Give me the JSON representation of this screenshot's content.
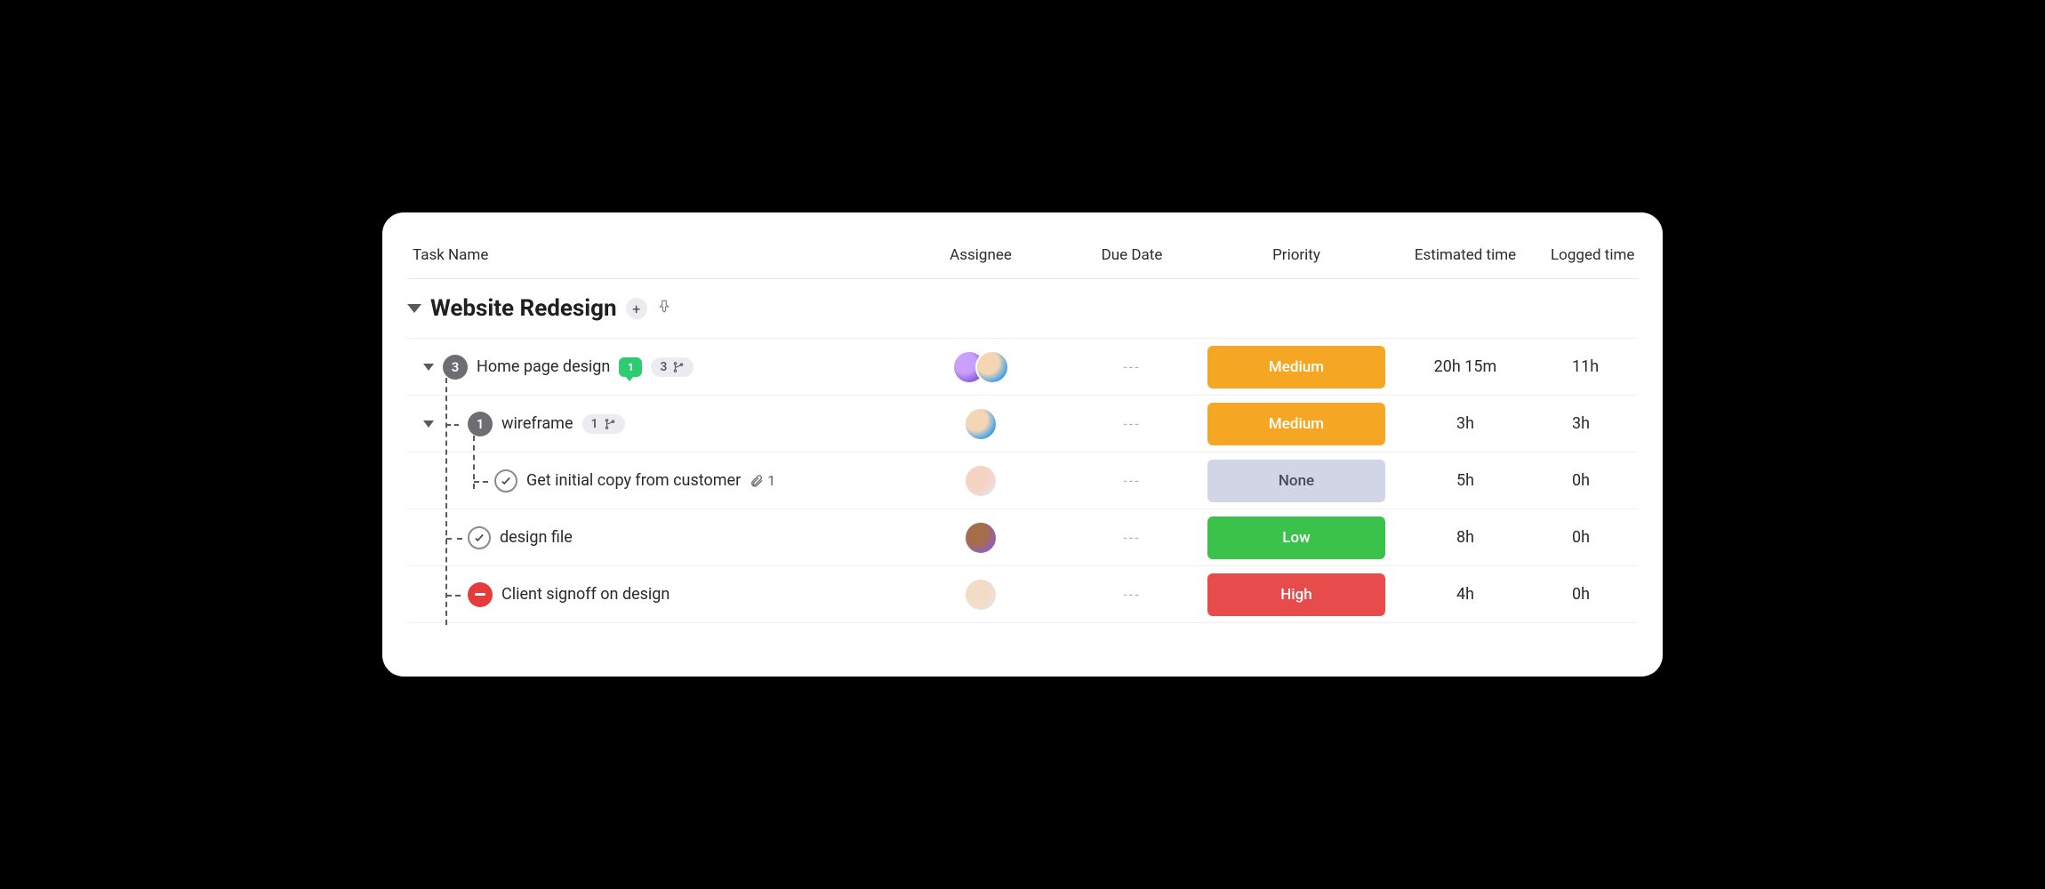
{
  "columns": {
    "task_name": "Task Name",
    "assignee": "Assignee",
    "due_date": "Due Date",
    "priority": "Priority",
    "estimated": "Estimated time",
    "logged": "Logged time"
  },
  "section": {
    "title": "Website Redesign",
    "add_label": "+"
  },
  "priority_labels": {
    "medium": "Medium",
    "none": "None",
    "low": "Low",
    "high": "High"
  },
  "tasks": [
    {
      "id": "home",
      "title": "Home page design",
      "subtask_count": "3",
      "comment_count": "1",
      "subtask_badge": "3",
      "due_date": "---",
      "priority": "medium",
      "estimated": "20h 15m",
      "logged": "11h"
    },
    {
      "id": "wireframe",
      "title": "wireframe",
      "subtask_count": "1",
      "subtask_badge": "1",
      "due_date": "---",
      "priority": "medium",
      "estimated": "3h",
      "logged": "3h"
    },
    {
      "id": "copy",
      "title": "Get initial copy from customer",
      "attachment_count": "1",
      "due_date": "---",
      "priority": "none",
      "estimated": "5h",
      "logged": "0h"
    },
    {
      "id": "designfile",
      "title": "design file",
      "due_date": "---",
      "priority": "low",
      "estimated": "8h",
      "logged": "0h"
    },
    {
      "id": "signoff",
      "title": "Client signoff on design",
      "due_date": "---",
      "priority": "high",
      "estimated": "4h",
      "logged": "0h"
    }
  ]
}
